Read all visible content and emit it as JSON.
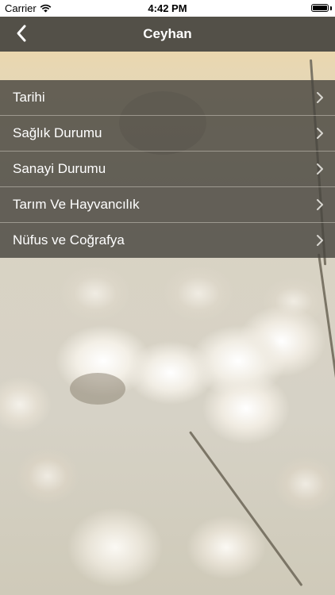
{
  "status_bar": {
    "carrier": "Carrier",
    "time": "4:42 PM",
    "battery_level": 1.0
  },
  "nav": {
    "title": "Ceyhan",
    "back_icon": "chevron-left-icon"
  },
  "menu": {
    "items": [
      {
        "label": "Tarihi"
      },
      {
        "label": "Sağlık Durumu"
      },
      {
        "label": "Sanayi Durumu"
      },
      {
        "label": "Tarım Ve Hayvancılık"
      },
      {
        "label": "Nüfus ve Coğrafya"
      }
    ],
    "chevron_icon": "chevron-right-icon"
  },
  "colors": {
    "nav_background": "#535048",
    "menu_background": "rgba(72,70,64,0.82)",
    "text": "#ffffff"
  }
}
